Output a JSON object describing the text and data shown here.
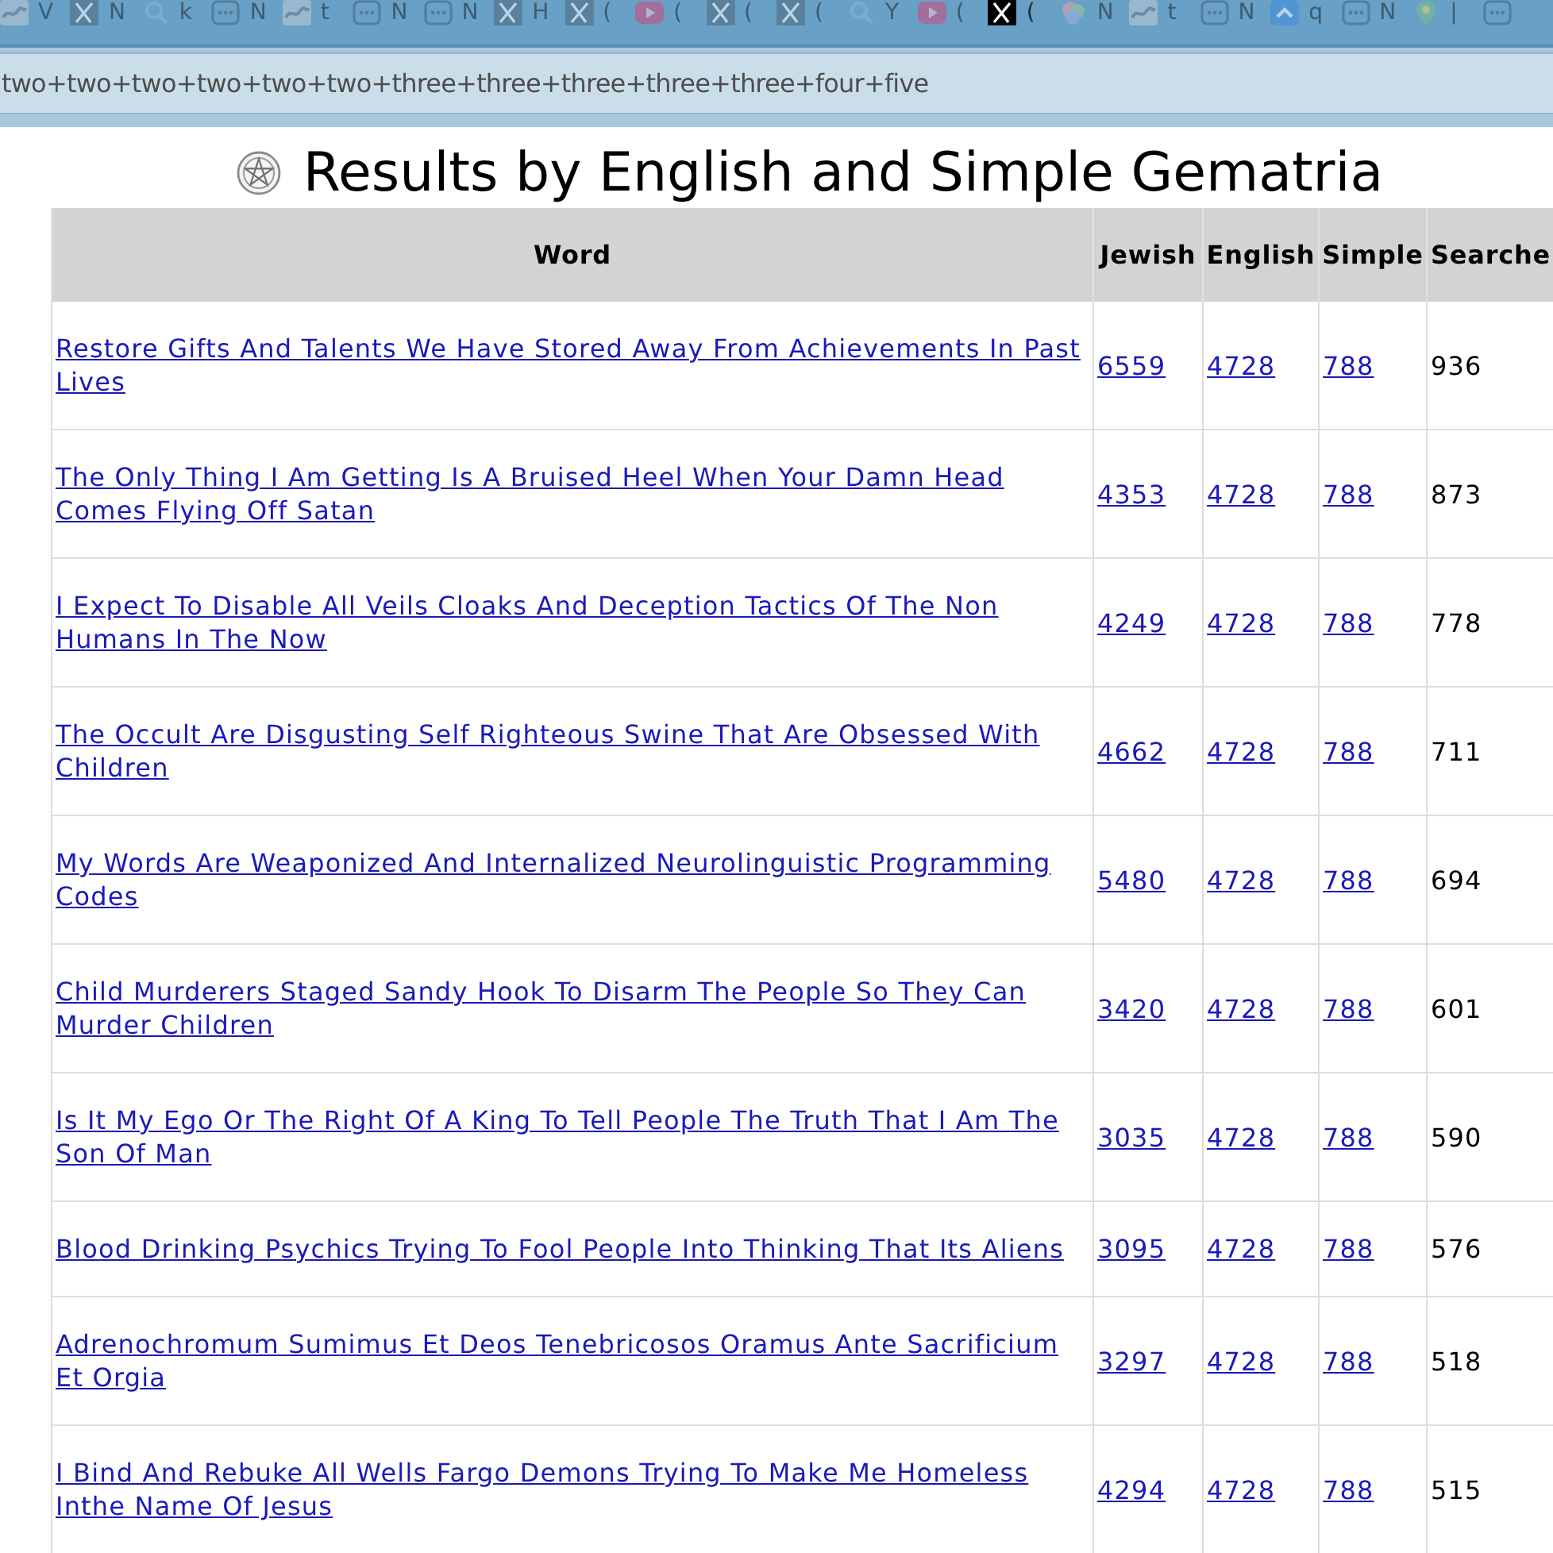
{
  "browser": {
    "tabs": [
      {
        "kind": "picture",
        "title": "V",
        "selected": false
      },
      {
        "kind": "x",
        "title": "N",
        "selected": false
      },
      {
        "kind": "search",
        "title": "k",
        "selected": false
      },
      {
        "kind": "dots",
        "title": "N",
        "selected": false
      },
      {
        "kind": "picture",
        "title": "t",
        "selected": false
      },
      {
        "kind": "dots",
        "title": "N",
        "selected": false
      },
      {
        "kind": "dots",
        "title": "N",
        "selected": false
      },
      {
        "kind": "x",
        "title": "H",
        "selected": false
      },
      {
        "kind": "x",
        "title": "(",
        "selected": false
      },
      {
        "kind": "play",
        "title": "(",
        "selected": false
      },
      {
        "kind": "x",
        "title": "(",
        "selected": false
      },
      {
        "kind": "x",
        "title": "(",
        "selected": false
      },
      {
        "kind": "search",
        "title": "Y",
        "selected": false
      },
      {
        "kind": "play",
        "title": "(",
        "selected": false
      },
      {
        "kind": "x",
        "title": "(",
        "selected": true
      },
      {
        "kind": "circles",
        "title": "N",
        "selected": false
      },
      {
        "kind": "picture",
        "title": "t",
        "selected": false
      },
      {
        "kind": "dots",
        "title": "N",
        "selected": false
      },
      {
        "kind": "chevron",
        "title": "q",
        "selected": false
      },
      {
        "kind": "dots",
        "title": "N",
        "selected": false
      },
      {
        "kind": "pin",
        "title": "|",
        "selected": false
      },
      {
        "kind": "dots",
        "selected": false
      }
    ],
    "address_bar": {
      "value": "two+two+two+two+two+two+three+three+three+three+three+four+five"
    }
  },
  "page": {
    "title": "Results by English and Simple Gematria",
    "table": {
      "columns": [
        "Word",
        "Jewish",
        "English",
        "Simple",
        "Searche"
      ],
      "rows": [
        {
          "word": "Restore Gifts And Talents We Have Stored Away From Achievements In Past Lives",
          "jewish": "6559",
          "english": "4728",
          "simple": "788",
          "searches": "936"
        },
        {
          "word": "The Only Thing I Am Getting Is A Bruised Heel When Your Damn Head Comes Flying Off Satan",
          "jewish": "4353",
          "english": "4728",
          "simple": "788",
          "searches": "873"
        },
        {
          "word": "I Expect To Disable All Veils Cloaks And Deception Tactics Of The Non Humans In The Now",
          "jewish": "4249",
          "english": "4728",
          "simple": "788",
          "searches": "778"
        },
        {
          "word": "The Occult Are Disgusting Self Righteous Swine That Are Obsessed With Children",
          "jewish": "4662",
          "english": "4728",
          "simple": "788",
          "searches": "711"
        },
        {
          "word": "My Words Are Weaponized And Internalized Neurolinguistic Programming Codes",
          "jewish": "5480",
          "english": "4728",
          "simple": "788",
          "searches": "694"
        },
        {
          "word": "Child Murderers Staged Sandy Hook To Disarm The People So They Can Murder Children",
          "jewish": "3420",
          "english": "4728",
          "simple": "788",
          "searches": "601"
        },
        {
          "word": "Is It My Ego Or The Right Of A King To Tell People The Truth That I Am The Son Of Man",
          "jewish": "3035",
          "english": "4728",
          "simple": "788",
          "searches": "590"
        },
        {
          "word": "Blood Drinking Psychics Trying To Fool People Into Thinking That Its Aliens",
          "jewish": "3095",
          "english": "4728",
          "simple": "788",
          "searches": "576"
        },
        {
          "word": "Adrenochromum Sumimus Et Deos Tenebricosos Oramus Ante Sacrificium Et Orgia",
          "jewish": "3297",
          "english": "4728",
          "simple": "788",
          "searches": "518"
        },
        {
          "word": "I Bind And Rebuke All Wells Fargo Demons Trying To Make Me Homeless Inthe Name Of Jesus",
          "jewish": "4294",
          "english": "4728",
          "simple": "788",
          "searches": "515"
        }
      ]
    }
  }
}
